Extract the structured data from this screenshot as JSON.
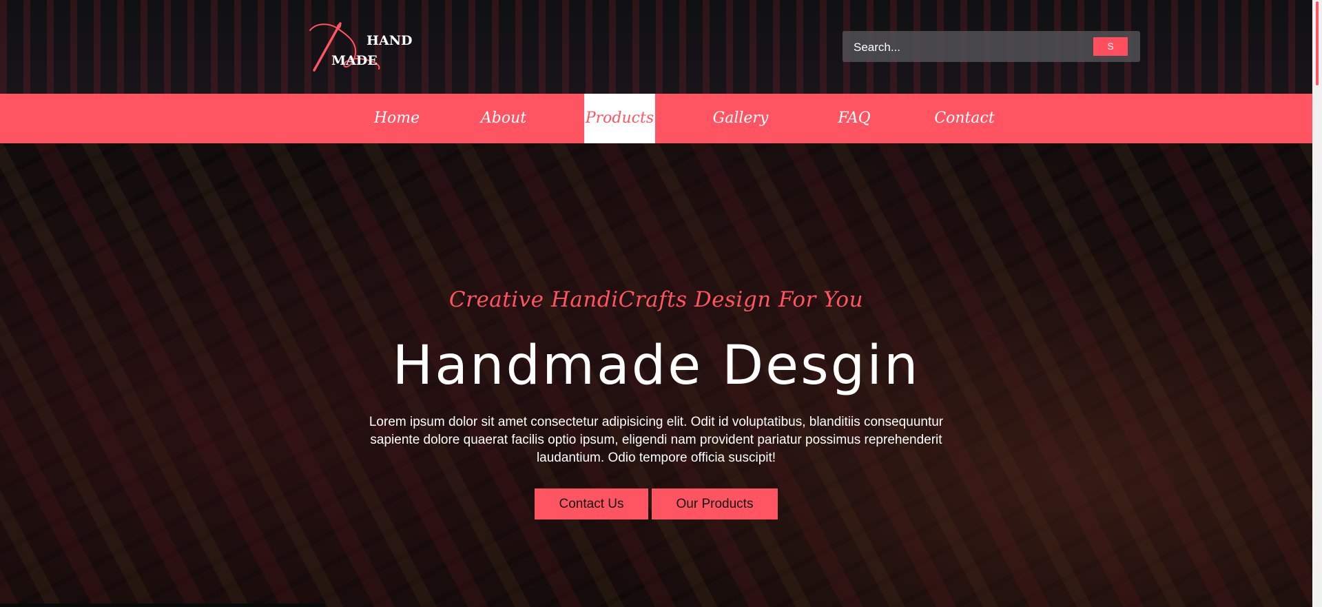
{
  "header": {
    "logo": {
      "line1": "HAND",
      "line2": "MADE"
    },
    "search": {
      "placeholder": "Search...",
      "button_label": "S"
    }
  },
  "nav": {
    "items": [
      {
        "label": "Home",
        "active": false
      },
      {
        "label": "About",
        "active": false
      },
      {
        "label": "Products",
        "active": true
      },
      {
        "label": "Gallery",
        "active": false
      },
      {
        "label": "FAQ",
        "active": false
      },
      {
        "label": "Contact",
        "active": false
      }
    ]
  },
  "hero": {
    "subtitle": "Creative HandiCrafts Design For You",
    "title": "Handmade Desgin",
    "text": "Lorem ipsum dolor sit amet consectetur adipisicing elit. Odit id voluptatibus, blanditiis consequuntur sapiente dolore quaerat facilis optio ipsum, eligendi nam provident pariatur possimus reprehenderit laudantium. Odio tempore officia suscipit!",
    "buttons": {
      "contact": "Contact Us",
      "products": "Our Products"
    }
  },
  "icons": {
    "logo": "needle-thread-icon"
  },
  "colors": {
    "accent": "#ff5562",
    "nav_active_bg": "#ffffff",
    "text_light": "#ffffff",
    "button_text": "#111111"
  }
}
